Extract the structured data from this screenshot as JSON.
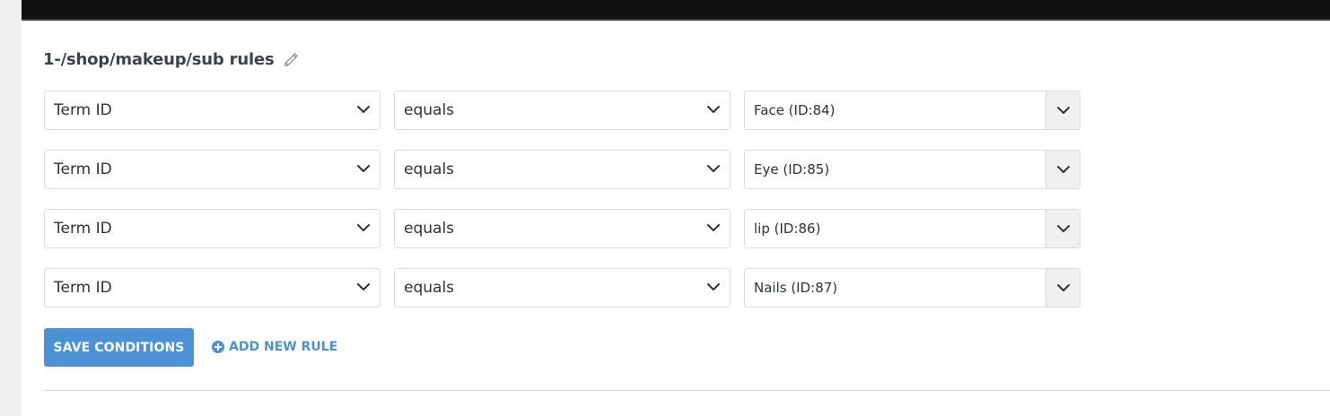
{
  "title": "1-/shop/makeup/sub rules",
  "rules": [
    {
      "field": "Term ID",
      "operator": "equals",
      "value": "Face (ID:84)"
    },
    {
      "field": "Term ID",
      "operator": "equals",
      "value": "Eye (ID:85)"
    },
    {
      "field": "Term ID",
      "operator": "equals",
      "value": "lip (ID:86)"
    },
    {
      "field": "Term ID",
      "operator": "equals",
      "value": "Nails (ID:87)"
    }
  ],
  "actions": {
    "save_label": "SAVE CONDITIONS",
    "add_rule_label": "ADD NEW RULE"
  },
  "icons": {
    "edit": "pencil-icon",
    "dropdown": "chevron-down-icon",
    "add": "plus-circle-icon"
  },
  "colors": {
    "accent": "#4b92d4",
    "top_bar": "#111111"
  }
}
